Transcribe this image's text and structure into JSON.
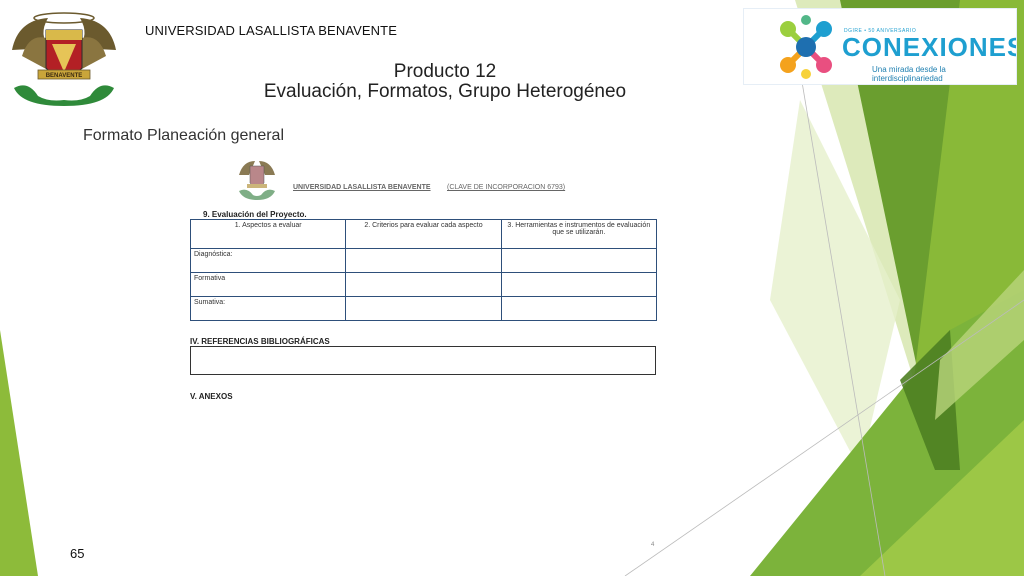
{
  "header": {
    "university": "UNIVERSIDAD LASALLISTA BENAVENTE",
    "title_line1": "Producto 12",
    "title_line2": "Evaluación, Formatos, Grupo Heterogéneo",
    "subtitle": "Formato Planeación general"
  },
  "crest": {
    "ribbon_text": "BENAVENTE"
  },
  "logo": {
    "small_text": "DGIRE • 50 ANIVERSARIO",
    "title": "CONEXIONES",
    "tagline": "Una mirada desde la interdisciplinariedad"
  },
  "document": {
    "header_name": "UNIVERSIDAD LASALLISTA BENAVENTE",
    "header_clave": "(CLAVE DE INCORPORACION 6793)",
    "section_9": "9. Evaluación del Proyecto.",
    "table": {
      "headers": [
        "1. Aspectos a evaluar",
        "2. Criterios para evaluar cada aspecto",
        "3. Herramientas e instrumentos de evaluación que se utilizarán."
      ],
      "rows": [
        "Diagnóstica:",
        "Formativa",
        "Sumativa:"
      ]
    },
    "section_iv": "IV. REFERENCIAS BIBLIOGRÁFICAS",
    "section_v": "V. ANEXOS",
    "page_number": "4"
  },
  "slide_number": "65",
  "colors": {
    "green_light": "#c7dd8f",
    "green_mid": "#8dbb3a",
    "green_dark": "#5e8f2c",
    "table_border": "#2e4f7a",
    "logo_blue": "#1e9fd0"
  }
}
